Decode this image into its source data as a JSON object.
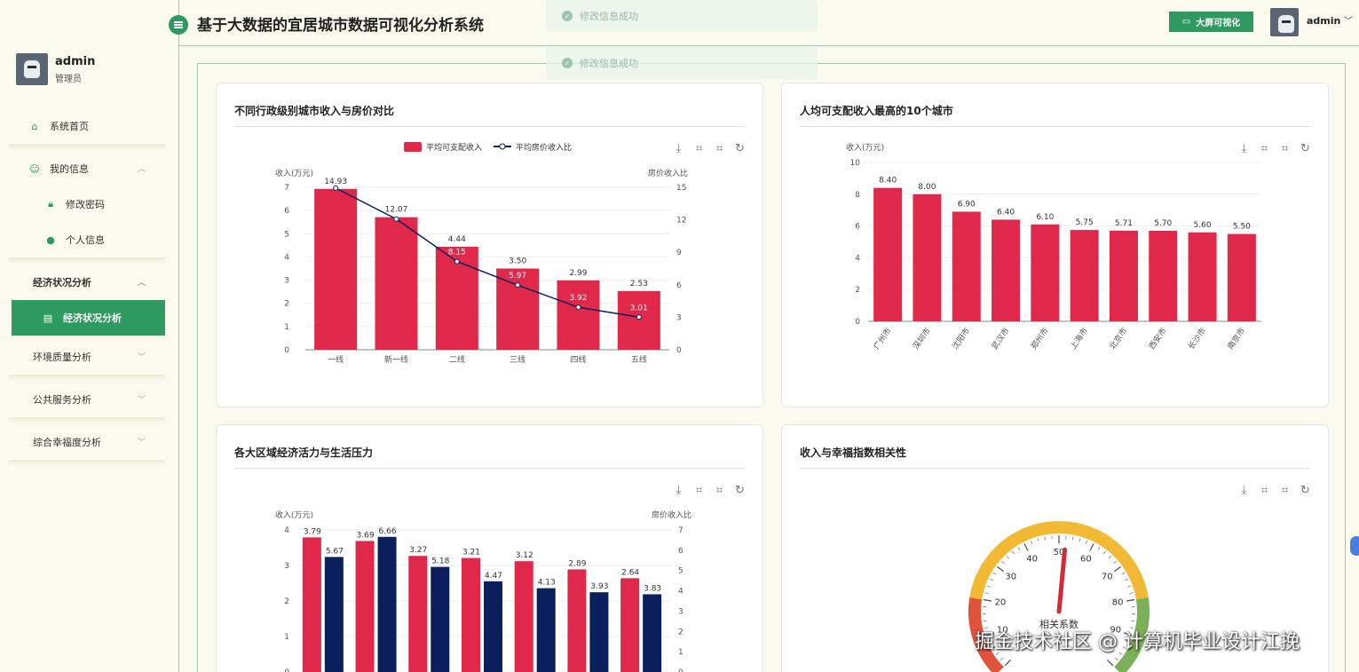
{
  "header": {
    "title": "基于大数据的宜居城市数据可视化分析系统",
    "big_screen": "大屏可视化",
    "username": "admin"
  },
  "toasts": [
    "修改信息成功",
    "修改信息成功"
  ],
  "user": {
    "name": "admin",
    "role": "管理员"
  },
  "menu": {
    "home": "系统首页",
    "my_info": "我的信息",
    "change_pwd": "修改密码",
    "personal": "个人信息",
    "econ_group": "经济状况分析",
    "econ_item": "经济状况分析",
    "env": "环境质量分析",
    "public": "公共服务分析",
    "happy": "综合幸福度分析"
  },
  "colors": {
    "accent": "#2e9a5f",
    "red": "#e0284a",
    "navy": "#0a1f5c"
  },
  "cards": {
    "c1": "不同行政级别城市收入与房价对比",
    "c2": "人均可支配收入最高的10个城市",
    "c3": "各大区域经济活力与生活压力",
    "c4": "收入与幸福指数相关性"
  },
  "chart_data": [
    {
      "type": "bar",
      "title": "不同行政级别城市收入与房价对比",
      "categories": [
        "一线",
        "新一线",
        "二线",
        "三线",
        "四线",
        "五线"
      ],
      "series": [
        {
          "name": "平均可支配收入",
          "values": [
            6.93,
            5.71,
            4.44,
            3.5,
            2.99,
            2.53
          ]
        },
        {
          "name": "平均房价收入比",
          "type": "line",
          "values": [
            14.93,
            12.07,
            8.15,
            5.97,
            3.92,
            3.01
          ]
        }
      ],
      "ylabel": "收入(万元)",
      "y2label": "房价收入比",
      "ylim": [
        0,
        7
      ],
      "y2lim": [
        0,
        15
      ],
      "yticks": [
        "0",
        "1",
        "2",
        "3",
        "4",
        "5",
        "6",
        "7"
      ],
      "y2ticks": [
        "0",
        "3",
        "6",
        "9",
        "12",
        "15"
      ],
      "labels1": [
        "14.93",
        "12.07",
        "4.44",
        "3.50",
        "2.99",
        "2.53"
      ],
      "labels2": [
        "8.15",
        "5.97",
        "3.92",
        "3.01"
      ],
      "legend": "top"
    },
    {
      "type": "bar",
      "title": "人均可支配收入最高的10个城市",
      "categories": [
        "广州市",
        "深圳市",
        "沈阳市",
        "武汉市",
        "郑州市",
        "上海市",
        "北京市",
        "西安市",
        "长沙市",
        "南京市"
      ],
      "values": [
        8.4,
        8.0,
        6.9,
        6.4,
        6.1,
        5.75,
        5.71,
        5.7,
        5.6,
        5.5
      ],
      "labels": [
        "8.40",
        "8.00",
        "6.90",
        "6.40",
        "6.10",
        "5.75",
        "5.71",
        "5.70",
        "5.60",
        "5.50"
      ],
      "ylabel": "收入(万元)",
      "ylim": [
        0,
        10
      ],
      "yticks": [
        "0",
        "2",
        "4",
        "6",
        "8",
        "10"
      ]
    },
    {
      "type": "bar",
      "title": "各大区域经济活力与生活压力",
      "series": [
        {
          "values": [
            3.79,
            3.69,
            3.27,
            3.21,
            3.12,
            2.89,
            2.64
          ]
        },
        {
          "values": [
            5.67,
            6.66,
            5.18,
            4.47,
            4.13,
            3.93,
            3.83
          ]
        }
      ],
      "labels1": [
        "3.79",
        "3.69",
        "3.27",
        "3.21",
        "3.12",
        "2.89",
        "2.64"
      ],
      "labels2": [
        "5.67",
        "6.66",
        "5.18",
        "4.47",
        "4.13",
        "3.93",
        "3.83"
      ],
      "ylabel": "收入(万元)",
      "y2label": "房价收入比",
      "ylim": [
        0,
        4
      ],
      "y2lim": [
        0,
        7
      ],
      "yticks": [
        "0",
        "1",
        "2",
        "3",
        "4"
      ],
      "y2ticks": [
        "0",
        "1",
        "2",
        "3",
        "4",
        "5",
        "6",
        "7"
      ]
    },
    {
      "type": "gauge",
      "title": "收入与幸福指数相关性",
      "ticks": [
        "10",
        "20",
        "30",
        "40",
        "50",
        "60",
        "70",
        "80",
        "90"
      ],
      "label": "相关系数",
      "value": 52
    }
  ],
  "watermark": "掘金技术社区 @ 计算机毕业设计江挽"
}
